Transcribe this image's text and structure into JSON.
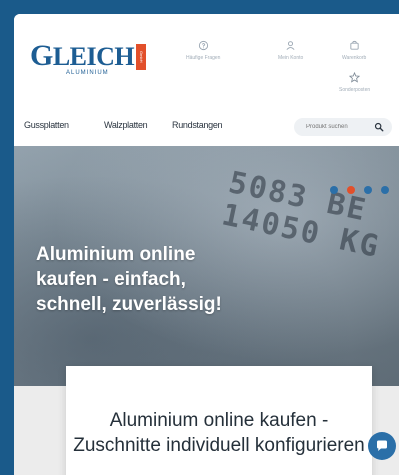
{
  "brand": {
    "name_first": "G",
    "name_rest": "LEICH",
    "sub": "ALUMINIUM",
    "badge": "GmbH"
  },
  "header_icons": [
    {
      "icon": "question-icon",
      "label": "Häufige Fragen"
    },
    {
      "icon": "user-icon",
      "label": "Mein Konto"
    },
    {
      "icon": "cart-icon",
      "label": "Warenkorb"
    },
    {
      "icon": "star-icon",
      "label": "Sonderposten"
    }
  ],
  "nav": {
    "items": [
      "Gussplatten",
      "Walzplatten",
      "Rundstangen"
    ]
  },
  "search": {
    "placeholder": "Produkt suchen"
  },
  "hero": {
    "stamp_line1": "5083 BE",
    "stamp_line2": "14050 KG",
    "headline": "Aluminium online kaufen - einfach, schnell, zuverlässig!",
    "dots": [
      "#2b6fa8",
      "#e2502b",
      "#2b6fa8",
      "#2b6fa8"
    ]
  },
  "card": {
    "text": "Aluminium online kaufen - Zuschnitte individuell konfigurieren"
  },
  "colors": {
    "brand_blue": "#1d5d93",
    "accent_red": "#e2502b",
    "page_bg": "#1a5a8a"
  }
}
